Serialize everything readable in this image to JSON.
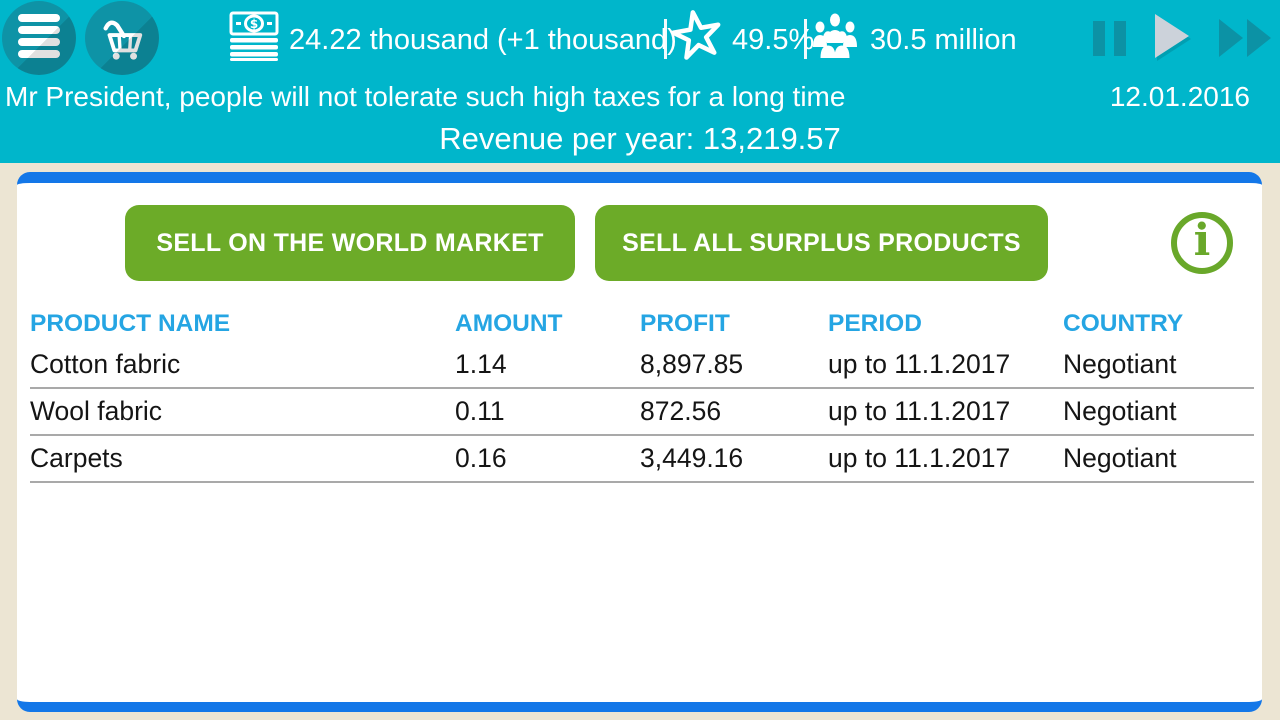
{
  "topbar": {
    "money_value": "24.22 thousand (+1 thousand)",
    "rating_value": "49.5%",
    "population_value": "30.5 million"
  },
  "ticker": {
    "message": "Mr President, people will not tolerate such high taxes for a long time",
    "date": "12.01.2016"
  },
  "revenue_line": "Revenue per year: 13,219.57",
  "actions": {
    "sell_world_market": "SELL ON THE WORLD MARKET",
    "sell_all_surplus": "SELL ALL SURPLUS PRODUCTS",
    "info_glyph": "i"
  },
  "table": {
    "headers": [
      "PRODUCT NAME",
      "AMOUNT",
      "PROFIT",
      "PERIOD",
      "COUNTRY"
    ],
    "rows": [
      [
        "Cotton fabric",
        "1.14",
        "8,897.85",
        "up to 11.1.2017",
        "Negotiant"
      ],
      [
        "Wool fabric",
        "0.11",
        "872.56",
        "up to 11.1.2017",
        "Negotiant"
      ],
      [
        "Carpets",
        "0.16",
        "3,449.16",
        "up to 11.1.2017",
        "Negotiant"
      ]
    ]
  },
  "icons": {
    "menu": "menu-icon",
    "cart": "cart-icon",
    "money": "money-icon",
    "rating": "star-icon",
    "population": "population-icon",
    "pause": "pause-icon",
    "play": "play-icon",
    "fast_forward": "fast-forward-icon",
    "info": "info-icon"
  },
  "colors": {
    "topbar_teal": "#00b6cb",
    "circle_button_teal": "#0e93a6",
    "card_border_blue": "#1377e8",
    "action_green": "#6cab28",
    "header_blue": "#25a5e3",
    "background_beige": "#ece5d3",
    "play_active_gray": "#ccd2da"
  }
}
